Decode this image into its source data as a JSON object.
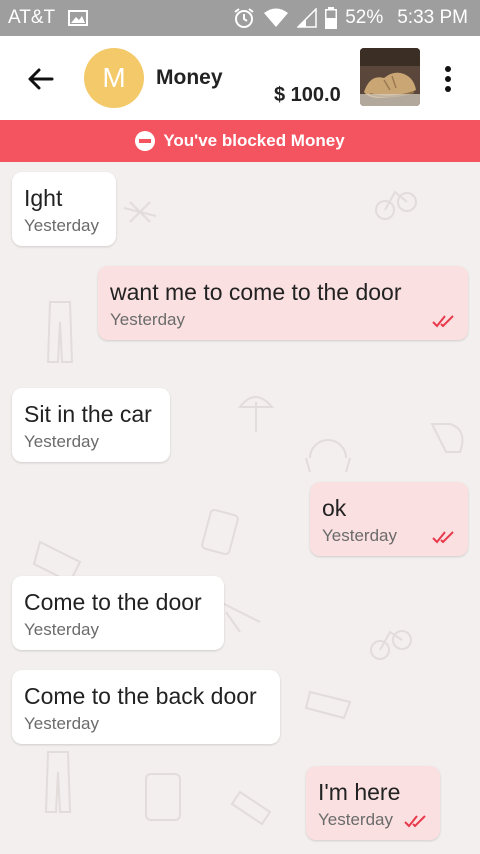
{
  "status_bar": {
    "carrier": "AT&T",
    "battery": "52%",
    "time": "5:33 PM"
  },
  "header": {
    "avatar_letter": "M",
    "contact_name": "Money",
    "price": "$ 100.0"
  },
  "banner": {
    "text": "You've blocked Money"
  },
  "messages": [
    {
      "direction": "in",
      "text": "Ight",
      "time": "Yesterday"
    },
    {
      "direction": "out",
      "text": "want me to come to the door",
      "time": "Yesterday",
      "read": true
    },
    {
      "direction": "in",
      "text": "Sit in the car",
      "time": "Yesterday"
    },
    {
      "direction": "out",
      "text": "ok",
      "time": "Yesterday",
      "read": true
    },
    {
      "direction": "in",
      "text": "Come to the door",
      "time": "Yesterday"
    },
    {
      "direction": "in",
      "text": "Come to the back door",
      "time": "Yesterday"
    },
    {
      "direction": "out",
      "text": "I'm here",
      "time": "Yesterday",
      "read": true
    }
  ],
  "colors": {
    "banner": "#f45360",
    "outgoing_bubble": "#fbe0e1",
    "incoming_bubble": "#ffffff",
    "avatar": "#f3c96a",
    "read_ticks": "#e8394a"
  }
}
